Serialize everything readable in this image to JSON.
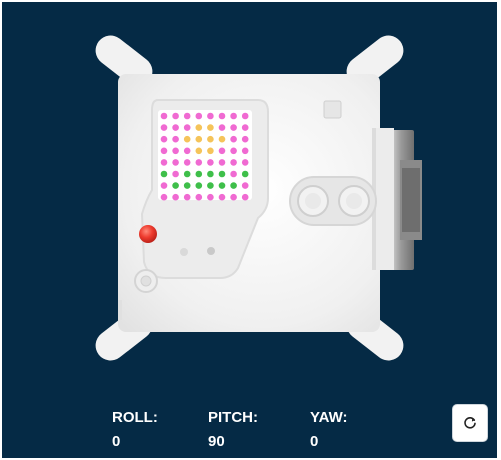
{
  "colors": {
    "background": "#052a45",
    "led_pink": "#f06ad2",
    "led_yellow": "#f5c45a",
    "led_green": "#3fbf4a",
    "button_red": "#e8332a"
  },
  "readouts": {
    "roll": {
      "label": "ROLL:",
      "value": "0"
    },
    "pitch": {
      "label": "PITCH:",
      "value": "90"
    },
    "yaw": {
      "label": "YAW:",
      "value": "0"
    }
  },
  "reset_button": {
    "icon": "refresh-icon"
  },
  "led_matrix": {
    "rows": 8,
    "cols": 8,
    "grid": [
      "PPPPPPPP",
      "PPPYYPPP",
      "PPYYYYPP",
      "PPPYYPPP",
      "PPPPPPPP",
      "GPGGGGPG",
      "PGGGGGGP",
      "PPPPPPPP"
    ]
  }
}
